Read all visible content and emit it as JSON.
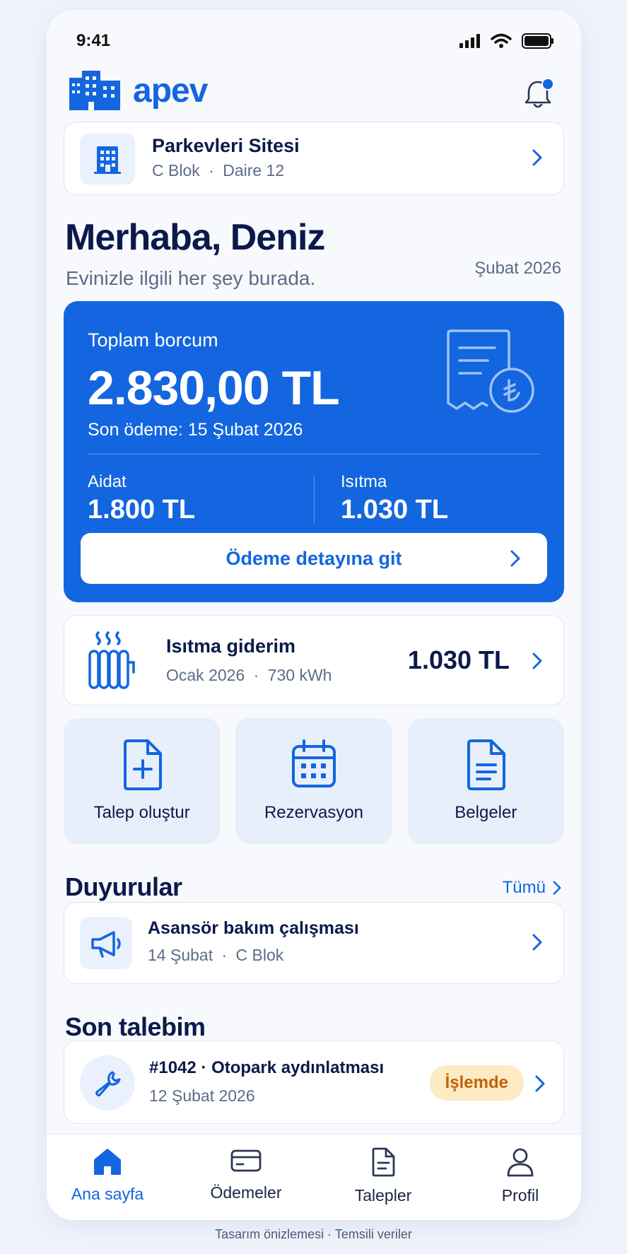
{
  "status": {
    "time": "9:41"
  },
  "app": {
    "name": "apev"
  },
  "site": {
    "name": "Parkevleri Sitesi",
    "block": "C Blok",
    "sep": "·",
    "unit": "Daire 12"
  },
  "greeting": {
    "title": "Merhaba, Deniz",
    "subtitle": "Evinizle ilgili her şey burada.",
    "month": "Şubat 2026"
  },
  "debt": {
    "label": "Toplam borcum",
    "amount": "2.830,00 TL",
    "due": "Son ödeme: 15 Şubat 2026",
    "dues_label": "Aidat",
    "dues_value": "1.800 TL",
    "heating_label": "Isıtma",
    "heating_value": "1.030 TL",
    "button": "Ödeme detayına git"
  },
  "heating": {
    "title": "Isıtma giderim",
    "period": "Ocak 2026",
    "sep": "·",
    "usage": "730 kWh",
    "amount": "1.030 TL"
  },
  "actions": [
    {
      "label": "Talep oluştur",
      "icon": "file-plus-icon"
    },
    {
      "label": "Rezervasyon",
      "icon": "calendar-icon"
    },
    {
      "label": "Belgeler",
      "icon": "document-icon"
    }
  ],
  "announcements": {
    "heading": "Duyurular",
    "all": "Tümü",
    "item": {
      "title": "Asansör bakım çalışması",
      "date": "14 Şubat",
      "sep": "·",
      "block": "C Blok"
    }
  },
  "request": {
    "heading": "Son talebim",
    "title": "#1042 · Otopark aydınlatması",
    "date": "12 Şubat 2026",
    "status": "İşlemde"
  },
  "nav": [
    {
      "label": "Ana sayfa",
      "icon": "home-icon",
      "active": true
    },
    {
      "label": "Ödemeler",
      "icon": "card-icon",
      "active": false
    },
    {
      "label": "Talepler",
      "icon": "document-icon",
      "active": false
    },
    {
      "label": "Profil",
      "icon": "user-icon",
      "active": false
    }
  ],
  "footer": "Tasarım önizlemesi · Temsili veriler",
  "colors": {
    "primary": "#1366e0",
    "text": "#0b1a4a",
    "muted": "#5d6b88",
    "badge_bg": "#fdebc4",
    "badge_text": "#c2620a"
  }
}
